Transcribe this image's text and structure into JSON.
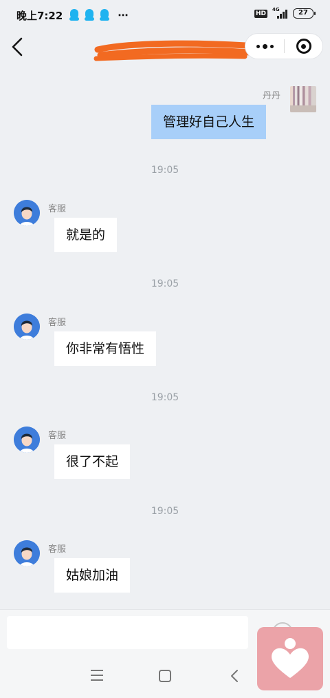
{
  "status_bar": {
    "time": "晚上7:22",
    "more": "⋯",
    "hd_label": "HD",
    "network_label": "4G",
    "battery": "27"
  },
  "header": {
    "title_redacted": true,
    "redaction_color": "#f26a21"
  },
  "messages": [
    {
      "type": "text",
      "side": "right",
      "sender": "丹丹",
      "text": "管理好自己人生"
    },
    {
      "type": "time",
      "text": "19:05"
    },
    {
      "type": "text",
      "side": "left",
      "sender": "客服",
      "text": "就是的"
    },
    {
      "type": "time",
      "text": "19:05"
    },
    {
      "type": "text",
      "side": "left",
      "sender": "客服",
      "text": "你非常有悟性"
    },
    {
      "type": "time",
      "text": "19:05"
    },
    {
      "type": "text",
      "side": "left",
      "sender": "客服",
      "text": "很了不起"
    },
    {
      "type": "time",
      "text": "19:05"
    },
    {
      "type": "text",
      "side": "left",
      "sender": "客服",
      "text": "姑娘加油"
    }
  ],
  "input": {
    "value": "",
    "placeholder": ""
  },
  "nav": {
    "icons": [
      "menu-icon",
      "home-icon",
      "back-icon"
    ]
  },
  "floating_button": {
    "icon": "heart-icon",
    "color": "#eba3a8"
  },
  "colors": {
    "background": "#eef0f3",
    "self_bubble": "#a8cff9",
    "other_bubble": "#ffffff",
    "avatar_blue": "#3e7ddb"
  }
}
